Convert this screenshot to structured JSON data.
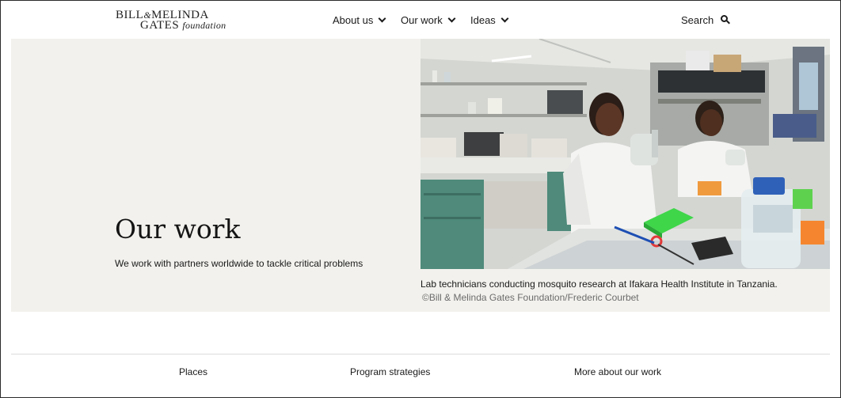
{
  "header": {
    "logo": {
      "line1_a": "BILL",
      "amp": "&",
      "line1_b": "MELINDA",
      "line2_a": "GATES",
      "line2_b": "foundation"
    },
    "nav": [
      {
        "label": "About us"
      },
      {
        "label": "Our work"
      },
      {
        "label": "Ideas"
      }
    ],
    "search_label": "Search"
  },
  "hero": {
    "title": "Our work",
    "subtitle": "We work with partners worldwide to tackle critical problems",
    "caption": "Lab technicians conducting mosquito research at Ifakara Health Institute in Tanzania.",
    "credit": "©Bill & Melinda Gates Foundation/Frederic Courbet"
  },
  "footer_nav": [
    {
      "label": "Places"
    },
    {
      "label": "Program strategies"
    },
    {
      "label": "More about our work"
    }
  ],
  "colors": {
    "hero_bg": "#f2f1ed",
    "text": "#1a1a1a",
    "credit": "#6c6c6c"
  }
}
